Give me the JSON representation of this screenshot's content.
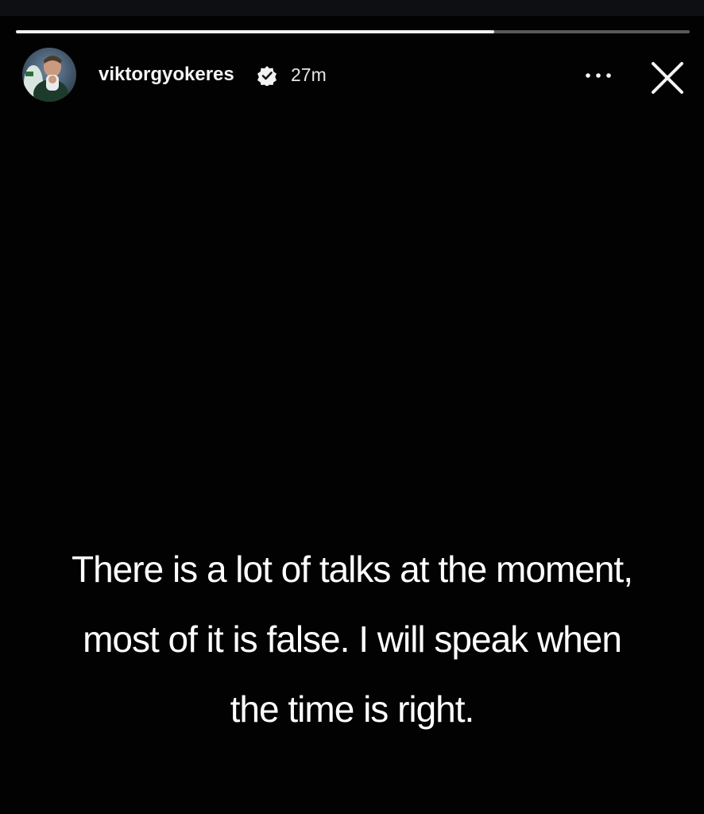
{
  "story": {
    "progress_fraction": 0.71,
    "username": "viktorgyokeres",
    "verified": true,
    "timestamp": "27m",
    "text_lines": [
      "There is a lot of talks at the moment,",
      "most of it is false. I will speak when",
      "the time is right."
    ]
  },
  "icons": {
    "verified": "verified-badge-icon",
    "more": "more-options-icon",
    "close": "close-icon"
  },
  "colors": {
    "background": "#020202",
    "text": "#ffffff",
    "progress_fill": "#f2f2f2"
  }
}
